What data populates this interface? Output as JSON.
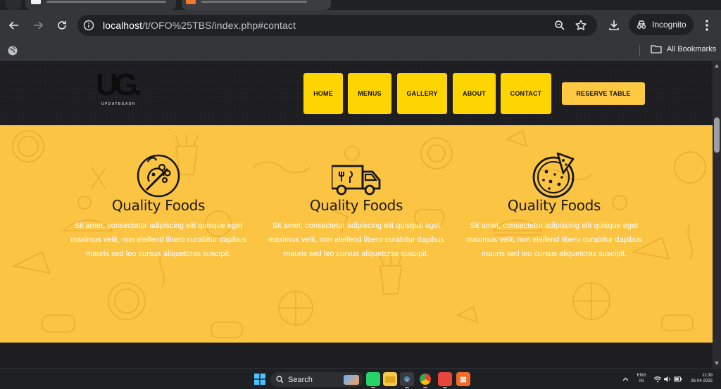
{
  "browser": {
    "url_host": "localhost",
    "url_path": "/t/OFO%25TBS/index.php#contact",
    "incognito_label": "Incognito",
    "bookmarks_label": "All Bookmarks"
  },
  "site": {
    "logo_mark": "UG.",
    "logo_tagline": "UPDATEGADH",
    "nav": [
      {
        "label": "HOME"
      },
      {
        "label": "MENUS"
      },
      {
        "label": "GALLERY"
      },
      {
        "label": "ABOUT"
      },
      {
        "label": "CONTACT"
      }
    ],
    "reserve_label": "RESERVE TABLE",
    "features": [
      {
        "icon": "food-icon",
        "title": "Quality Foods",
        "text": "Sit amet, consectetur adipiscing elit quisque eget maximus velit, non eleifend libero curabitur dapibus mauris sed leo cursus aliquetcras suscipit."
      },
      {
        "icon": "food-truck-icon",
        "title": "Quality Foods",
        "text": "Sit amet, consectetur adipiscing elit quisque eget maximus velit, non eleifend libero curabitur dapibus mauris sed leo cursus aliquetcras suscipit."
      },
      {
        "icon": "pizza-icon",
        "title": "Quality Foods",
        "text": "Sit amet, consectetur adipiscing elit quisque eget maximus velit, non eleifend libero curabitur dapibus mauris sed leo cursus aliquetcras suscipit."
      }
    ],
    "colors": {
      "nav_yellow": "#ffd500",
      "section_yellow": "#fbc443",
      "header_dark": "#1e1e22"
    }
  },
  "taskbar": {
    "search_label": "Search",
    "lang_line1": "ENG",
    "lang_line2": "IN",
    "time": "11:39",
    "date": "26-04-2025"
  }
}
